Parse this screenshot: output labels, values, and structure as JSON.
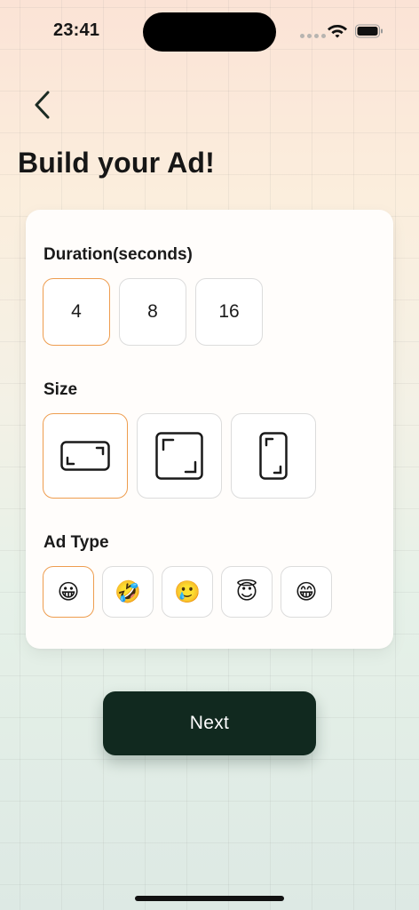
{
  "status_bar": {
    "time": "23:41"
  },
  "header": {
    "back_icon": "chevron-left-icon",
    "title": "Build your Ad!"
  },
  "duration": {
    "label": "Duration(seconds)",
    "options": [
      "4",
      "8",
      "16"
    ],
    "selected": "4"
  },
  "size": {
    "label": "Size",
    "options": [
      {
        "icon": "landscape-frame-icon"
      },
      {
        "icon": "square-frame-icon"
      },
      {
        "icon": "portrait-frame-icon"
      }
    ],
    "selected_index": 0
  },
  "ad_type": {
    "label": "Ad Type",
    "options": [
      "😀",
      "🤣",
      "🥲",
      "😇",
      "😁"
    ],
    "selected_index": 0
  },
  "next_label": "Next",
  "colors": {
    "accent_border": "#ee9d4f",
    "button_bg": "#11291f"
  }
}
